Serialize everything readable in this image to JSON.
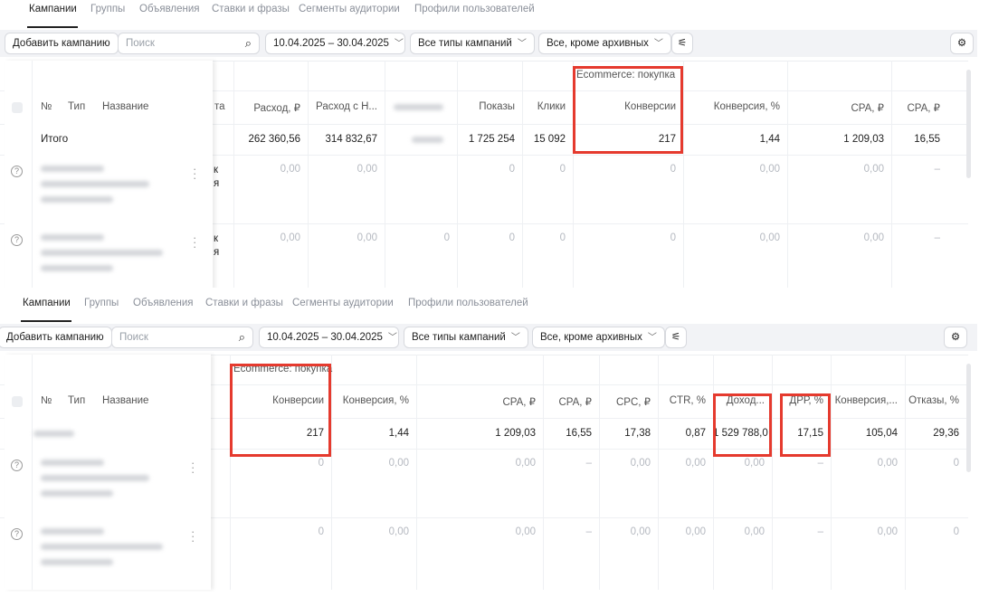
{
  "tabs": [
    "Кампании",
    "Группы",
    "Объявления",
    "Ставки и фразы",
    "Сегменты аудитории",
    "Профили пользователей"
  ],
  "toolbar": {
    "add_campaign": "Добавить кампанию",
    "search_placeholder": "Поиск",
    "date_range": "10.04.2025 – 30.04.2025",
    "campaign_types": "Все типы кампаний",
    "status_filter": "Все, кроме архивных"
  },
  "fixed_headers": {
    "num": "№",
    "type": "Тип",
    "name": "Название",
    "total": "Итого"
  },
  "goal_group": "Ecommerce: покупка",
  "accent_color": "#e53a2e",
  "panel1": {
    "partial_col": {
      "header": "та",
      "rows": [
        "к\nя",
        "к\nя"
      ]
    },
    "columns": [
      {
        "header": "Расход, ₽",
        "total": "262 360,56",
        "rows": [
          "0,00",
          "0,00"
        ]
      },
      {
        "header": "Расход с Н...",
        "total": "314 832,67",
        "rows": [
          "0,00",
          "0,00"
        ]
      },
      {
        "header": "",
        "total": "",
        "rows": [
          "",
          "0"
        ]
      },
      {
        "header": "Показы",
        "total": "1 725 254",
        "rows": [
          "0",
          "0"
        ]
      },
      {
        "header": "Клики",
        "total": "15 092",
        "rows": [
          "0",
          "0"
        ]
      },
      {
        "header": "Конверсии",
        "total": "217",
        "rows": [
          "0",
          "0"
        ]
      },
      {
        "header": "Конверсия, %",
        "total": "1,44",
        "rows": [
          "0,00",
          "0,00"
        ]
      },
      {
        "header": "CPA, ₽",
        "total": "1 209,03",
        "rows": [
          "0,00",
          "0,00"
        ]
      },
      {
        "header": "CPA, ₽",
        "total": "16,55",
        "rows": [
          "–",
          "–"
        ]
      }
    ]
  },
  "panel2": {
    "columns": [
      {
        "header": "Конверсии",
        "total": "217",
        "rows": [
          "0",
          "0"
        ]
      },
      {
        "header": "Конверсия, %",
        "total": "1,44",
        "rows": [
          "0,00",
          "0,00"
        ]
      },
      {
        "header": "CPA, ₽",
        "total": "1 209,03",
        "rows": [
          "0,00",
          "0,00"
        ]
      },
      {
        "header": "CPA, ₽",
        "total": "16,55",
        "rows": [
          "–",
          "–"
        ]
      },
      {
        "header": "CPC, ₽",
        "total": "17,38",
        "rows": [
          "0,00",
          "0,00"
        ]
      },
      {
        "header": "CTR, %",
        "total": "0,87",
        "rows": [
          "0,00",
          "0,00"
        ]
      },
      {
        "header": "Доход...",
        "total": "1 529 788,0",
        "rows": [
          "0,00",
          "0,00"
        ]
      },
      {
        "header": "ДРР, %",
        "total": "17,15",
        "rows": [
          "–",
          "–"
        ]
      },
      {
        "header": "Конверсия,...",
        "total": "105,04",
        "rows": [
          "0,00",
          "0,00"
        ]
      },
      {
        "header": "Отказы, %",
        "total": "29,36",
        "rows": [
          "0",
          "0"
        ]
      }
    ]
  }
}
